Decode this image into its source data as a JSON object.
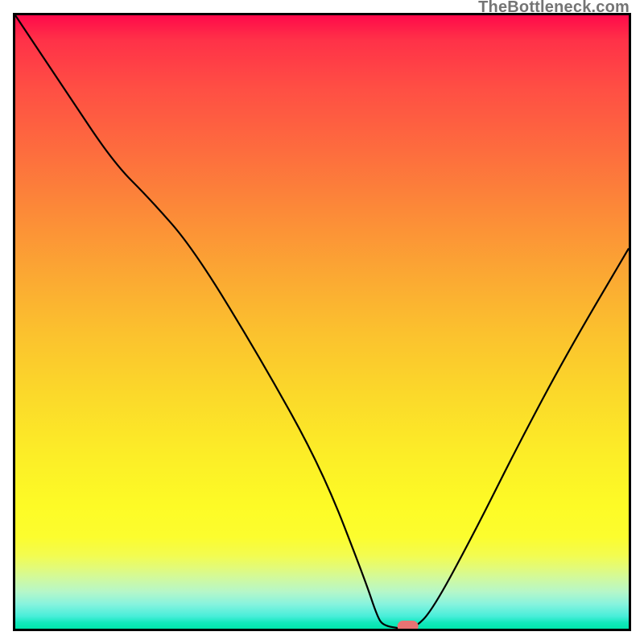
{
  "watermark": "TheBottleneck.com",
  "chart_data": {
    "type": "line",
    "title": "",
    "xlabel": "",
    "ylabel": "",
    "xlim": [
      0,
      100
    ],
    "ylim": [
      0,
      100
    ],
    "grid": false,
    "series": [
      {
        "name": "bottleneck-curve",
        "x": [
          0,
          8,
          16,
          22,
          29,
          40,
          50,
          57,
          59,
          60,
          63,
          65,
          68,
          75,
          82,
          90,
          100
        ],
        "values": [
          100,
          88,
          76,
          70,
          62,
          44,
          26,
          8,
          2,
          0.5,
          0,
          0,
          3,
          16,
          30,
          45,
          62
        ]
      }
    ],
    "marker": {
      "name": "optimal-point",
      "x": 64,
      "y": 0,
      "color": "#e97373",
      "shape": "pill"
    },
    "background": {
      "type": "vertical-gradient",
      "stops": [
        {
          "pos": 0,
          "color": "#ff0a4a"
        },
        {
          "pos": 12,
          "color": "#ff4f44"
        },
        {
          "pos": 32,
          "color": "#fc8a38"
        },
        {
          "pos": 52,
          "color": "#fbc22e"
        },
        {
          "pos": 72,
          "color": "#fcee27"
        },
        {
          "pos": 88,
          "color": "#e3fb78"
        },
        {
          "pos": 96,
          "color": "#87f3de"
        },
        {
          "pos": 100,
          "color": "#00e6ac"
        }
      ]
    }
  }
}
